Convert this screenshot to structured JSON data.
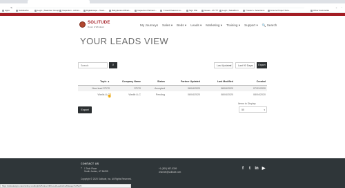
{
  "browser": {
    "url": "sinkudesigns.mascrwnhq.com/English/Partners/MCLoud/LeadsView/Manage",
    "bookmarks": [
      "Apps",
      "Solidworks",
      "Login | Naamber Group",
      "Inspection - Admin...",
      "Digitalscape - Team...",
      "Babyplanned Brain...",
      "Inspection Partners...",
      "7 Good Reasons to...",
      "Sign Shit",
      "Issues - M-TTT",
      "Login | SalesBurn",
      "Trusted + Selections",
      "Ensure Project Sole...",
      "Other bookmarks"
    ]
  },
  "header": {
    "logo_text": "SOLITUDE",
    "logo_sub": "Doors & Windows",
    "nav": [
      "My Journeys",
      "Sales ▾",
      "Beds ▾",
      "Leads ▾",
      "Marketing ▾",
      "Training ▾",
      "Support ▾",
      "🔍 Search"
    ]
  },
  "main": {
    "title": "YOUR LEADS VIEW",
    "search_placeholder": "Search",
    "search_button_icon": "search-icon",
    "filter_1": "Last Updated",
    "filter_2": "Last 90 Days",
    "export_top": "Export",
    "table": {
      "headers": [
        "Topic ▲",
        "Company Name",
        "Status",
        "Partner Updated",
        "Last Modified",
        "Created"
      ],
      "rows": [
        [
          "New lead STCS",
          "STCS",
          "Accepted",
          "08/04/2020",
          "08/04/2020",
          "07/31/2020"
        ],
        [
          "Warlls LLC",
          "Warlib LLC",
          "Pending",
          "08/04/2020",
          "08/04/2020",
          "08/04/2020"
        ]
      ]
    },
    "export_button": "Export",
    "items_label": "Items to Display",
    "items_value": "50"
  },
  "footer": {
    "heading": "CONTACT US",
    "address_line_1": "1 Tech Place",
    "address_line_2": "South Jordan, UT 84095",
    "phone": "+1 (800) 867-5309",
    "email": "channel@solitude.com",
    "copyright": "Copyright © 2020 Solitude, Inc. All Rights Reserved.",
    "status_url": "https://sinkudesigns.mascrwnhq.com/English/Partners/MCLoud/LeadsView/Manage?id=5a7d"
  },
  "colors": {
    "brand_red": "#a31d24",
    "dark_button": "#2b2f31",
    "footer_bg": "#2f3639"
  }
}
